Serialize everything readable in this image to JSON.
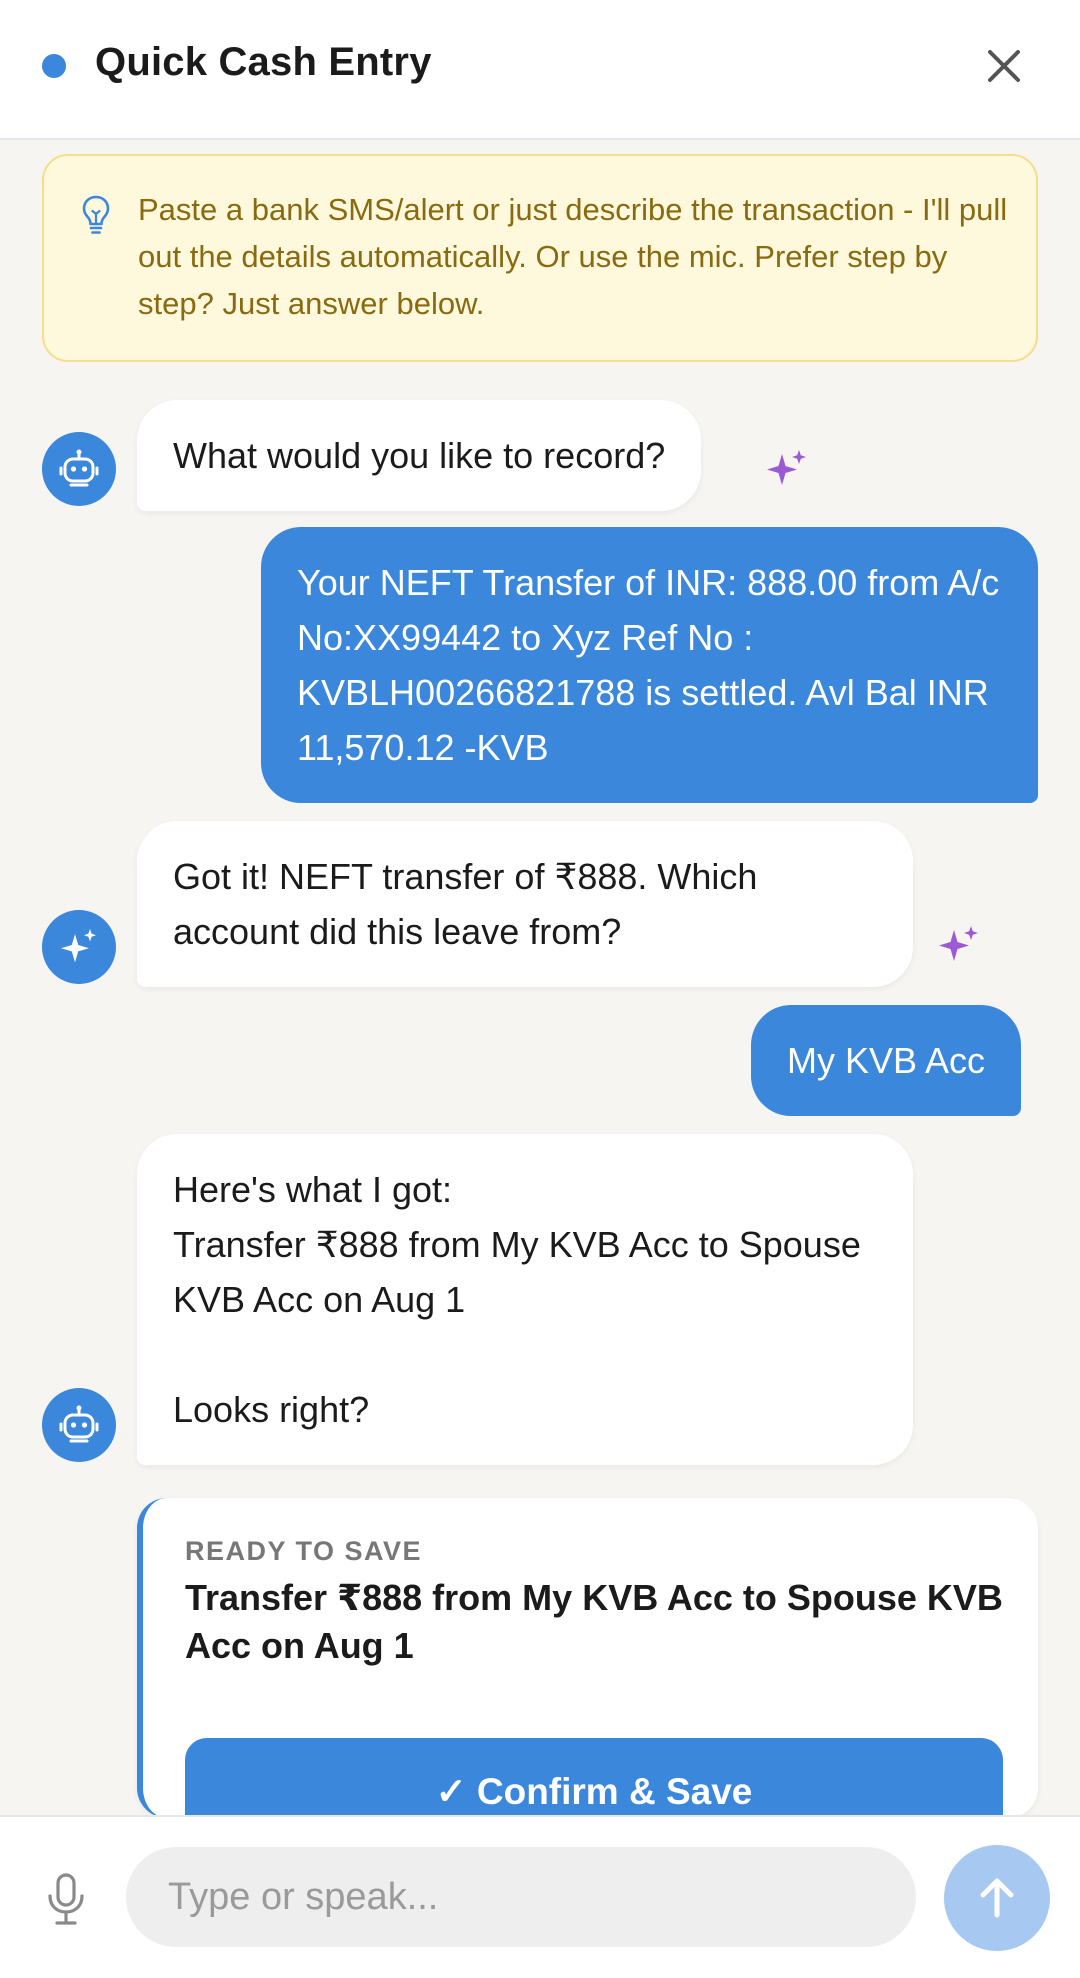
{
  "header": {
    "title": "Quick Cash Entry",
    "status_color": "#3a87dc"
  },
  "hint": {
    "icon": "lightbulb-icon",
    "text": "Paste a bank SMS/alert or just describe the transaction - I'll pull out the details automatically. Or use the mic. Prefer step by step? Just answer below."
  },
  "messages": [
    {
      "role": "bot",
      "icon": "robot-icon",
      "text": "What would you like to record?"
    },
    {
      "role": "user",
      "text": "Your NEFT Transfer of INR: 888.00 from A/c No:XX99442 to Xyz Ref No : KVBLH00266821788 is settled. Avl Bal INR 11,570.12 -KVB"
    },
    {
      "role": "bot",
      "icon": "sparkles-icon",
      "text": "Got it! NEFT transfer of ₹888. Which account did this leave from?"
    },
    {
      "role": "user",
      "text": "My KVB Acc"
    },
    {
      "role": "bot",
      "icon": "robot-icon",
      "text": "Here's what I got:\nTransfer ₹888 from My KVB Acc to Spouse KVB Acc on Aug 1\n\nLooks right?"
    }
  ],
  "card": {
    "kicker": "READY TO SAVE",
    "summary": "Transfer ₹888 from My KVB Acc to Spouse KVB Acc on Aug 1",
    "confirm_label": "✓ Confirm & Save"
  },
  "composer": {
    "placeholder": "Type or speak...",
    "send_icon": "arrow-up-icon",
    "mic_icon": "mic-icon"
  },
  "colors": {
    "accent": "#3a87dc",
    "hint_bg": "#fef8dc",
    "hint_text": "#8a6a10",
    "sparkle": "#9b59d6"
  }
}
